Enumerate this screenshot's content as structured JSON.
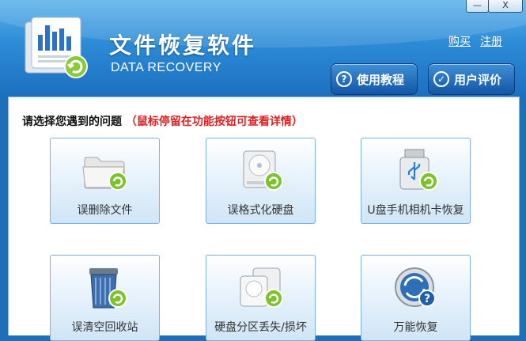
{
  "window": {
    "minimize": "—",
    "close": "X"
  },
  "header": {
    "title": "文件恢复软件",
    "subtitle": "DATA RECOVERY",
    "links": {
      "buy": "购买",
      "register": "注册"
    },
    "buttons": [
      {
        "label": "使用教程",
        "icon": "question-icon"
      },
      {
        "label": "用户评价",
        "icon": "thumbs-up-icon"
      }
    ]
  },
  "prompt": {
    "text": "请选择您遇到的问题",
    "hint": "（鼠标停留在功能按钮可查看详情）"
  },
  "tiles": [
    {
      "label": "误删除文件",
      "icon": "folder-icon"
    },
    {
      "label": "误格式化硬盘",
      "icon": "hard-drive-icon"
    },
    {
      "label": "U盘手机相机卡恢复",
      "icon": "usb-drive-icon"
    },
    {
      "label": "误清空回收站",
      "icon": "recycle-bin-icon"
    },
    {
      "label": "硬盘分区丢失/损坏",
      "icon": "partition-icon"
    },
    {
      "label": "万能恢复",
      "icon": "universal-recovery-icon"
    }
  ],
  "colors": {
    "accent": "#2c8bd6",
    "hint": "#e02020",
    "restore_green": "#7cc32b"
  }
}
